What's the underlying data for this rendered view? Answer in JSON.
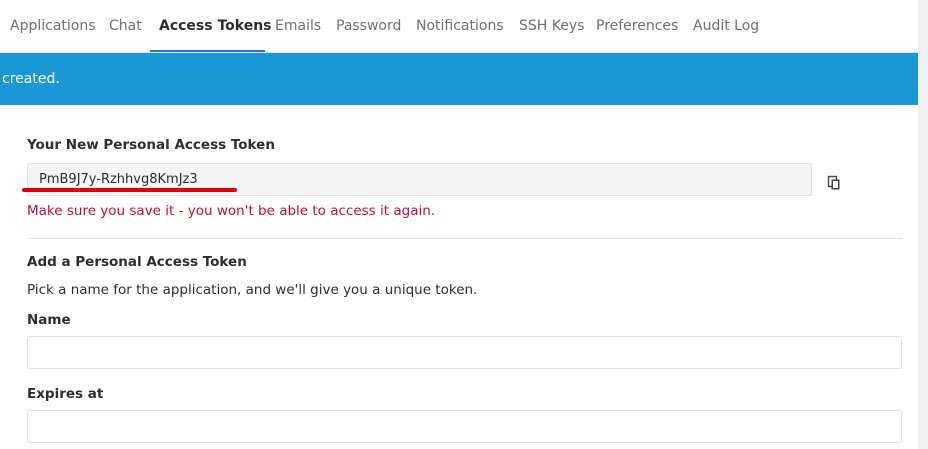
{
  "nav": {
    "tabs": [
      "Applications",
      "Chat",
      "Access Tokens",
      "Emails",
      "Password",
      "Notifications",
      "SSH Keys",
      "Preferences",
      "Audit Log"
    ],
    "active_tab": "Access Tokens"
  },
  "flash": {
    "message": "created."
  },
  "new_token": {
    "heading": "Your New Personal Access Token",
    "value": "PmB9J7y-Rzhhvg8KmJz3",
    "warning": "Make sure you save it - you won't be able to access it again.",
    "copy_icon": "clipboard-icon"
  },
  "add_token": {
    "heading": "Add a Personal Access Token",
    "description": "Pick a name for the application, and we'll give you a unique token.",
    "name_label": "Name",
    "name_value": "",
    "expires_label": "Expires at",
    "expires_value": ""
  },
  "colors": {
    "flash_bg": "#1a98d6",
    "warning_text": "#c0112b",
    "active_tab_underline": "#1f78d1",
    "redaction_mark": "#e00000"
  }
}
